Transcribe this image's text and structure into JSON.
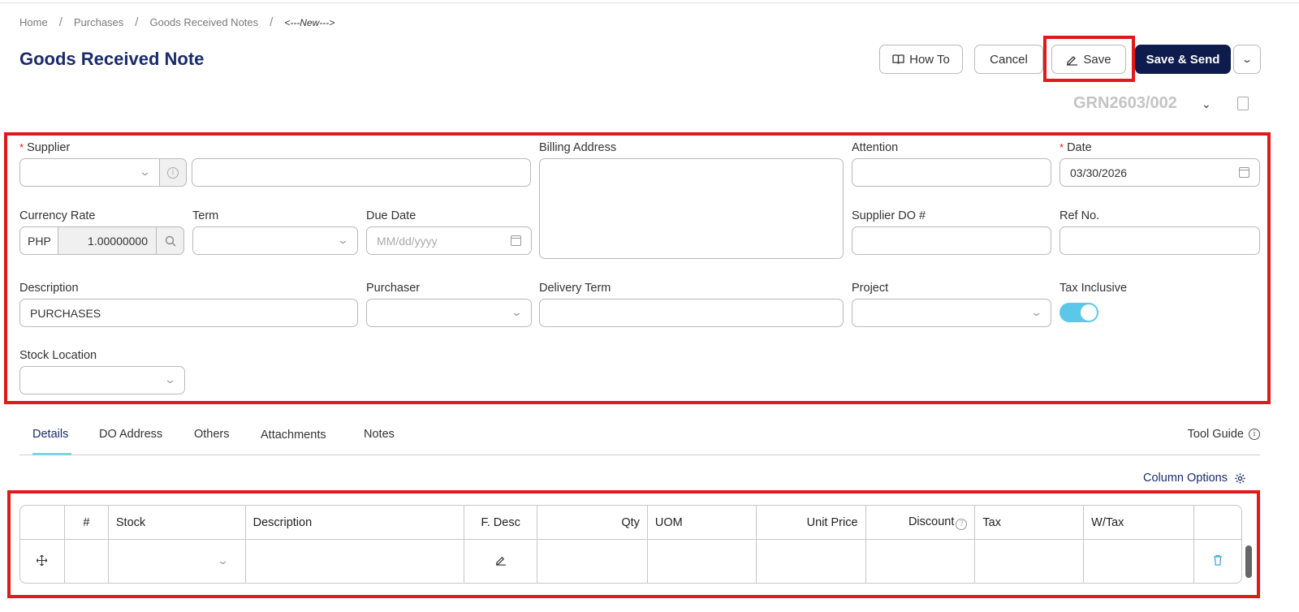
{
  "breadcrumb": [
    "Home",
    "Purchases",
    "Goods Received Notes",
    "<---New--->"
  ],
  "page_title": "Goods Received Note",
  "toolbar": {
    "how_to": "How To",
    "cancel": "Cancel",
    "save": "Save",
    "save_send": "Save & Send"
  },
  "doc_number": "GRN2603/002",
  "form": {
    "supplier_label": "Supplier",
    "billing_address_label": "Billing Address",
    "attention_label": "Attention",
    "date_label": "Date",
    "date_value": "03/30/2026",
    "currency_rate_label": "Currency Rate",
    "currency_code": "PHP",
    "currency_rate_value": "1.00000000",
    "term_label": "Term",
    "due_date_label": "Due Date",
    "due_date_placeholder": "MM/dd/yyyy",
    "supplier_do_label": "Supplier DO #",
    "ref_no_label": "Ref No.",
    "description_label": "Description",
    "description_value": "PURCHASES",
    "purchaser_label": "Purchaser",
    "delivery_term_label": "Delivery Term",
    "project_label": "Project",
    "tax_inclusive_label": "Tax Inclusive",
    "tax_inclusive_on": true,
    "stock_location_label": "Stock Location"
  },
  "tabs": [
    "Details",
    "DO Address",
    "Others",
    "Attachments",
    "Notes"
  ],
  "tool_guide": "Tool Guide",
  "column_options": "Column Options",
  "table": {
    "headers": [
      "#",
      "Stock",
      "Description",
      "F. Desc",
      "Qty",
      "UOM",
      "Unit Price",
      "Discount",
      "Tax",
      "W/Tax"
    ]
  },
  "colors": {
    "accent": "#0d1b4d",
    "title": "#1a2b6b",
    "highlight": "#e0191b",
    "toggle": "#5bc8ea"
  }
}
